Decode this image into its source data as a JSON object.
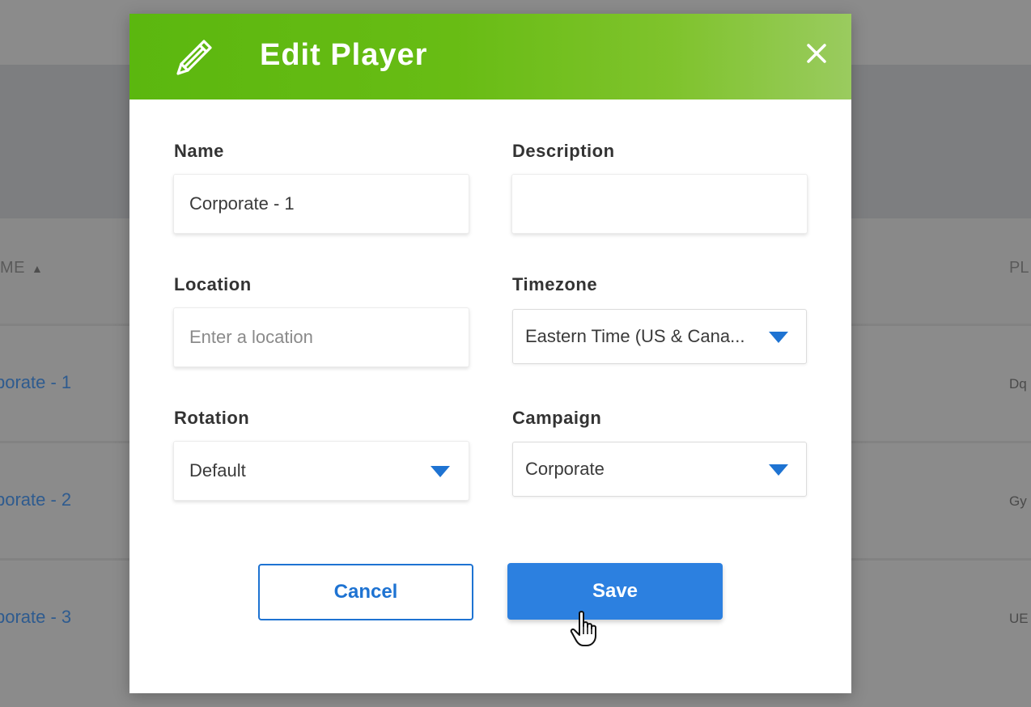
{
  "background": {
    "column_name_header": "ME",
    "column_pl_header": "PL",
    "rows": [
      {
        "name": "porate - 1",
        "code": "Dq"
      },
      {
        "name": "porate - 2",
        "code": "Gy"
      },
      {
        "name": "porate - 3",
        "code": "UE"
      }
    ]
  },
  "modal": {
    "title": "Edit Player",
    "header_icon": "pencil-icon",
    "close_icon": "close-icon",
    "fields": {
      "name": {
        "label": "Name",
        "value": "Corporate - 1"
      },
      "description": {
        "label": "Description",
        "value": ""
      },
      "location": {
        "label": "Location",
        "value": "",
        "placeholder": "Enter a location"
      },
      "timezone": {
        "label": "Timezone",
        "value": "Eastern Time (US & Cana..."
      },
      "rotation": {
        "label": "Rotation",
        "value": "Default"
      },
      "campaign": {
        "label": "Campaign",
        "value": "Corporate"
      }
    },
    "buttons": {
      "cancel": "Cancel",
      "save": "Save"
    }
  },
  "colors": {
    "header_green": "#5bb70f",
    "accent_blue": "#2c80e0",
    "link_blue": "#2e5b8f"
  }
}
